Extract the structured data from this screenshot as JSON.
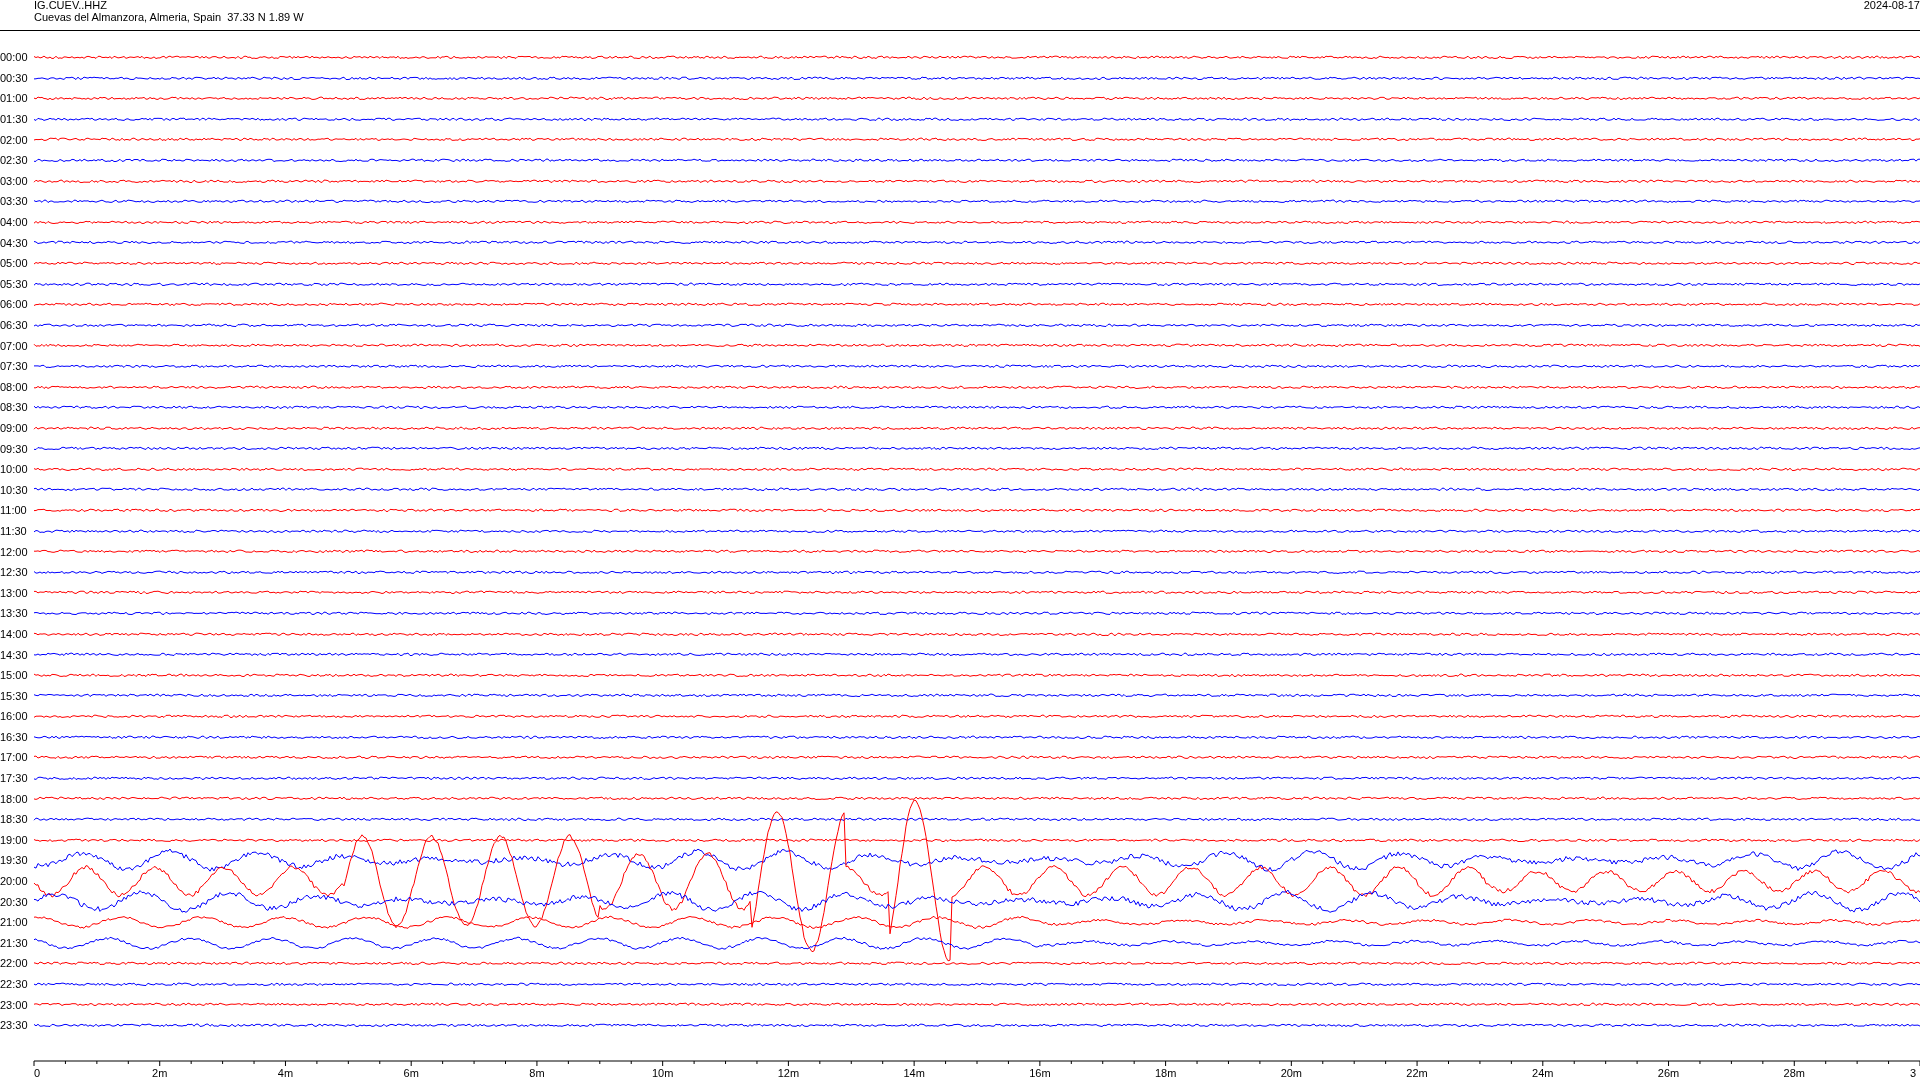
{
  "header": {
    "station": "IG.CUEV..HHZ",
    "location": "Cuevas del Almanzora, Almeria, Spain  37.33 N 1.89 W",
    "date": "2024-08-17"
  },
  "traces": [
    {
      "time": "00:00",
      "color": "#ff0000",
      "kind": "quiet"
    },
    {
      "time": "00:30",
      "color": "#0000ff",
      "kind": "quiet"
    },
    {
      "time": "01:00",
      "color": "#ff0000",
      "kind": "quiet"
    },
    {
      "time": "01:30",
      "color": "#0000ff",
      "kind": "quiet"
    },
    {
      "time": "02:00",
      "color": "#ff0000",
      "kind": "quiet"
    },
    {
      "time": "02:30",
      "color": "#0000ff",
      "kind": "quiet"
    },
    {
      "time": "03:00",
      "color": "#ff0000",
      "kind": "quiet"
    },
    {
      "time": "03:30",
      "color": "#0000ff",
      "kind": "quiet"
    },
    {
      "time": "04:00",
      "color": "#ff0000",
      "kind": "quiet"
    },
    {
      "time": "04:30",
      "color": "#0000ff",
      "kind": "quiet"
    },
    {
      "time": "05:00",
      "color": "#ff0000",
      "kind": "quiet"
    },
    {
      "time": "05:30",
      "color": "#0000ff",
      "kind": "quiet"
    },
    {
      "time": "06:00",
      "color": "#ff0000",
      "kind": "quiet"
    },
    {
      "time": "06:30",
      "color": "#0000ff",
      "kind": "quiet"
    },
    {
      "time": "07:00",
      "color": "#ff0000",
      "kind": "quiet"
    },
    {
      "time": "07:30",
      "color": "#0000ff",
      "kind": "quiet"
    },
    {
      "time": "08:00",
      "color": "#ff0000",
      "kind": "quiet"
    },
    {
      "time": "08:30",
      "color": "#0000ff",
      "kind": "quiet"
    },
    {
      "time": "09:00",
      "color": "#ff0000",
      "kind": "quiet"
    },
    {
      "time": "09:30",
      "color": "#0000ff",
      "kind": "quiet"
    },
    {
      "time": "10:00",
      "color": "#ff0000",
      "kind": "quiet"
    },
    {
      "time": "10:30",
      "color": "#0000ff",
      "kind": "quiet"
    },
    {
      "time": "11:00",
      "color": "#ff0000",
      "kind": "quiet"
    },
    {
      "time": "11:30",
      "color": "#0000ff",
      "kind": "quiet"
    },
    {
      "time": "12:00",
      "color": "#ff0000",
      "kind": "quiet"
    },
    {
      "time": "12:30",
      "color": "#0000ff",
      "kind": "quiet"
    },
    {
      "time": "13:00",
      "color": "#ff0000",
      "kind": "quiet"
    },
    {
      "time": "13:30",
      "color": "#0000ff",
      "kind": "quiet"
    },
    {
      "time": "14:00",
      "color": "#ff0000",
      "kind": "quiet"
    },
    {
      "time": "14:30",
      "color": "#0000ff",
      "kind": "quiet"
    },
    {
      "time": "15:00",
      "color": "#ff0000",
      "kind": "quiet"
    },
    {
      "time": "15:30",
      "color": "#0000ff",
      "kind": "quiet"
    },
    {
      "time": "16:00",
      "color": "#ff0000",
      "kind": "quiet"
    },
    {
      "time": "16:30",
      "color": "#0000ff",
      "kind": "quiet"
    },
    {
      "time": "17:00",
      "color": "#ff0000",
      "kind": "quiet"
    },
    {
      "time": "17:30",
      "color": "#0000ff",
      "kind": "quiet"
    },
    {
      "time": "18:00",
      "color": "#ff0000",
      "kind": "quiet"
    },
    {
      "time": "18:30",
      "color": "#0000ff",
      "kind": "quiet"
    },
    {
      "time": "19:00",
      "color": "#ff0000",
      "kind": "quiet"
    },
    {
      "time": "19:30",
      "color": "#0000ff",
      "kind": "wave"
    },
    {
      "time": "20:00",
      "color": "#ff0000",
      "kind": "strong"
    },
    {
      "time": "20:30",
      "color": "#0000ff",
      "kind": "wave"
    },
    {
      "time": "21:00",
      "color": "#ff0000",
      "kind": "swell"
    },
    {
      "time": "21:30",
      "color": "#0000ff",
      "kind": "swell"
    },
    {
      "time": "22:00",
      "color": "#ff0000",
      "kind": "quiet"
    },
    {
      "time": "22:30",
      "color": "#0000ff",
      "kind": "quiet"
    },
    {
      "time": "23:00",
      "color": "#ff0000",
      "kind": "quiet"
    },
    {
      "time": "23:30",
      "color": "#0000ff",
      "kind": "quiet"
    }
  ],
  "axis": {
    "labels": [
      "0",
      "2m",
      "4m",
      "6m",
      "8m",
      "10m",
      "12m",
      "14m",
      "16m",
      "18m",
      "20m",
      "22m",
      "24m",
      "26m",
      "28m",
      "3"
    ]
  }
}
